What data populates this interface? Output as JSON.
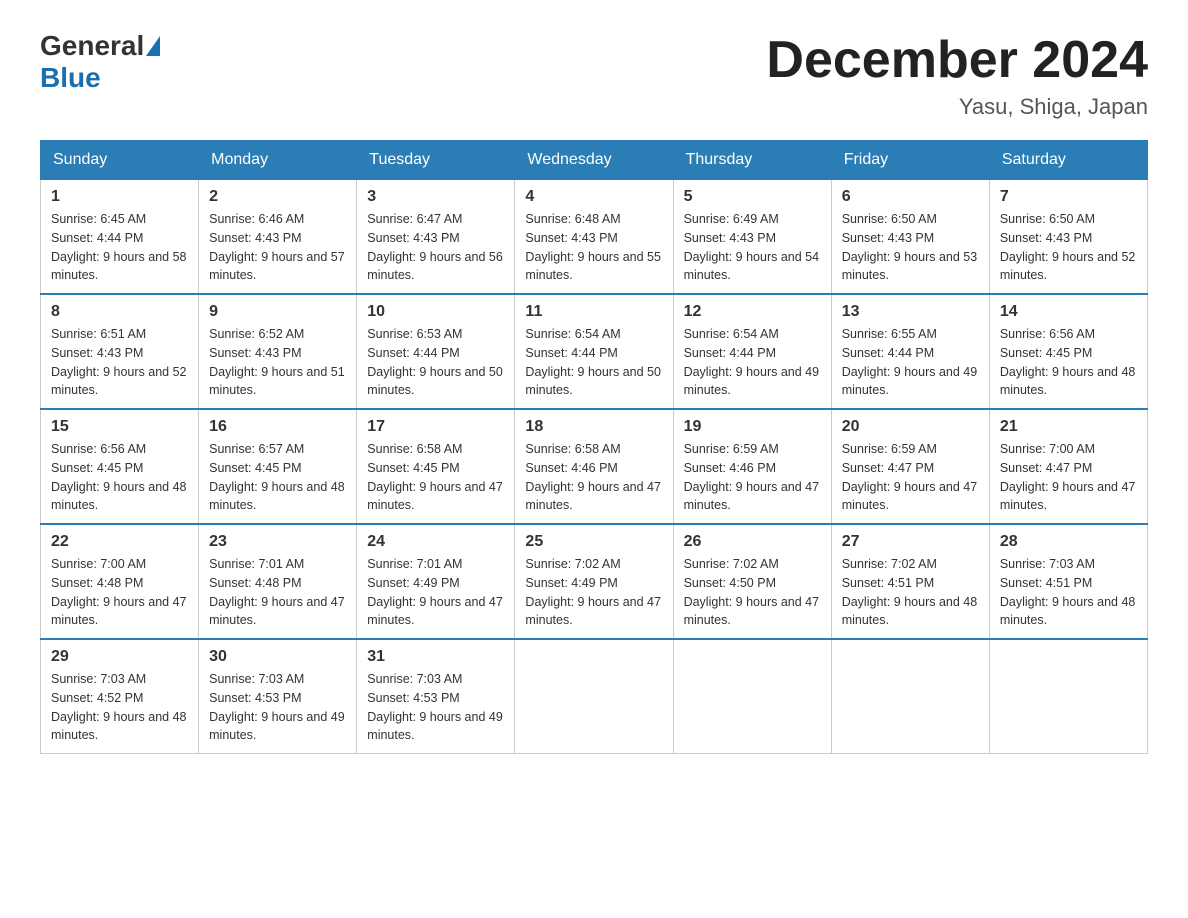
{
  "logo": {
    "general": "General",
    "blue": "Blue"
  },
  "title": "December 2024",
  "subtitle": "Yasu, Shiga, Japan",
  "days_of_week": [
    "Sunday",
    "Monday",
    "Tuesday",
    "Wednesday",
    "Thursday",
    "Friday",
    "Saturday"
  ],
  "weeks": [
    [
      {
        "date": "1",
        "sunrise": "Sunrise: 6:45 AM",
        "sunset": "Sunset: 4:44 PM",
        "daylight": "Daylight: 9 hours and 58 minutes."
      },
      {
        "date": "2",
        "sunrise": "Sunrise: 6:46 AM",
        "sunset": "Sunset: 4:43 PM",
        "daylight": "Daylight: 9 hours and 57 minutes."
      },
      {
        "date": "3",
        "sunrise": "Sunrise: 6:47 AM",
        "sunset": "Sunset: 4:43 PM",
        "daylight": "Daylight: 9 hours and 56 minutes."
      },
      {
        "date": "4",
        "sunrise": "Sunrise: 6:48 AM",
        "sunset": "Sunset: 4:43 PM",
        "daylight": "Daylight: 9 hours and 55 minutes."
      },
      {
        "date": "5",
        "sunrise": "Sunrise: 6:49 AM",
        "sunset": "Sunset: 4:43 PM",
        "daylight": "Daylight: 9 hours and 54 minutes."
      },
      {
        "date": "6",
        "sunrise": "Sunrise: 6:50 AM",
        "sunset": "Sunset: 4:43 PM",
        "daylight": "Daylight: 9 hours and 53 minutes."
      },
      {
        "date": "7",
        "sunrise": "Sunrise: 6:50 AM",
        "sunset": "Sunset: 4:43 PM",
        "daylight": "Daylight: 9 hours and 52 minutes."
      }
    ],
    [
      {
        "date": "8",
        "sunrise": "Sunrise: 6:51 AM",
        "sunset": "Sunset: 4:43 PM",
        "daylight": "Daylight: 9 hours and 52 minutes."
      },
      {
        "date": "9",
        "sunrise": "Sunrise: 6:52 AM",
        "sunset": "Sunset: 4:43 PM",
        "daylight": "Daylight: 9 hours and 51 minutes."
      },
      {
        "date": "10",
        "sunrise": "Sunrise: 6:53 AM",
        "sunset": "Sunset: 4:44 PM",
        "daylight": "Daylight: 9 hours and 50 minutes."
      },
      {
        "date": "11",
        "sunrise": "Sunrise: 6:54 AM",
        "sunset": "Sunset: 4:44 PM",
        "daylight": "Daylight: 9 hours and 50 minutes."
      },
      {
        "date": "12",
        "sunrise": "Sunrise: 6:54 AM",
        "sunset": "Sunset: 4:44 PM",
        "daylight": "Daylight: 9 hours and 49 minutes."
      },
      {
        "date": "13",
        "sunrise": "Sunrise: 6:55 AM",
        "sunset": "Sunset: 4:44 PM",
        "daylight": "Daylight: 9 hours and 49 minutes."
      },
      {
        "date": "14",
        "sunrise": "Sunrise: 6:56 AM",
        "sunset": "Sunset: 4:45 PM",
        "daylight": "Daylight: 9 hours and 48 minutes."
      }
    ],
    [
      {
        "date": "15",
        "sunrise": "Sunrise: 6:56 AM",
        "sunset": "Sunset: 4:45 PM",
        "daylight": "Daylight: 9 hours and 48 minutes."
      },
      {
        "date": "16",
        "sunrise": "Sunrise: 6:57 AM",
        "sunset": "Sunset: 4:45 PM",
        "daylight": "Daylight: 9 hours and 48 minutes."
      },
      {
        "date": "17",
        "sunrise": "Sunrise: 6:58 AM",
        "sunset": "Sunset: 4:45 PM",
        "daylight": "Daylight: 9 hours and 47 minutes."
      },
      {
        "date": "18",
        "sunrise": "Sunrise: 6:58 AM",
        "sunset": "Sunset: 4:46 PM",
        "daylight": "Daylight: 9 hours and 47 minutes."
      },
      {
        "date": "19",
        "sunrise": "Sunrise: 6:59 AM",
        "sunset": "Sunset: 4:46 PM",
        "daylight": "Daylight: 9 hours and 47 minutes."
      },
      {
        "date": "20",
        "sunrise": "Sunrise: 6:59 AM",
        "sunset": "Sunset: 4:47 PM",
        "daylight": "Daylight: 9 hours and 47 minutes."
      },
      {
        "date": "21",
        "sunrise": "Sunrise: 7:00 AM",
        "sunset": "Sunset: 4:47 PM",
        "daylight": "Daylight: 9 hours and 47 minutes."
      }
    ],
    [
      {
        "date": "22",
        "sunrise": "Sunrise: 7:00 AM",
        "sunset": "Sunset: 4:48 PM",
        "daylight": "Daylight: 9 hours and 47 minutes."
      },
      {
        "date": "23",
        "sunrise": "Sunrise: 7:01 AM",
        "sunset": "Sunset: 4:48 PM",
        "daylight": "Daylight: 9 hours and 47 minutes."
      },
      {
        "date": "24",
        "sunrise": "Sunrise: 7:01 AM",
        "sunset": "Sunset: 4:49 PM",
        "daylight": "Daylight: 9 hours and 47 minutes."
      },
      {
        "date": "25",
        "sunrise": "Sunrise: 7:02 AM",
        "sunset": "Sunset: 4:49 PM",
        "daylight": "Daylight: 9 hours and 47 minutes."
      },
      {
        "date": "26",
        "sunrise": "Sunrise: 7:02 AM",
        "sunset": "Sunset: 4:50 PM",
        "daylight": "Daylight: 9 hours and 47 minutes."
      },
      {
        "date": "27",
        "sunrise": "Sunrise: 7:02 AM",
        "sunset": "Sunset: 4:51 PM",
        "daylight": "Daylight: 9 hours and 48 minutes."
      },
      {
        "date": "28",
        "sunrise": "Sunrise: 7:03 AM",
        "sunset": "Sunset: 4:51 PM",
        "daylight": "Daylight: 9 hours and 48 minutes."
      }
    ],
    [
      {
        "date": "29",
        "sunrise": "Sunrise: 7:03 AM",
        "sunset": "Sunset: 4:52 PM",
        "daylight": "Daylight: 9 hours and 48 minutes."
      },
      {
        "date": "30",
        "sunrise": "Sunrise: 7:03 AM",
        "sunset": "Sunset: 4:53 PM",
        "daylight": "Daylight: 9 hours and 49 minutes."
      },
      {
        "date": "31",
        "sunrise": "Sunrise: 7:03 AM",
        "sunset": "Sunset: 4:53 PM",
        "daylight": "Daylight: 9 hours and 49 minutes."
      },
      null,
      null,
      null,
      null
    ]
  ]
}
